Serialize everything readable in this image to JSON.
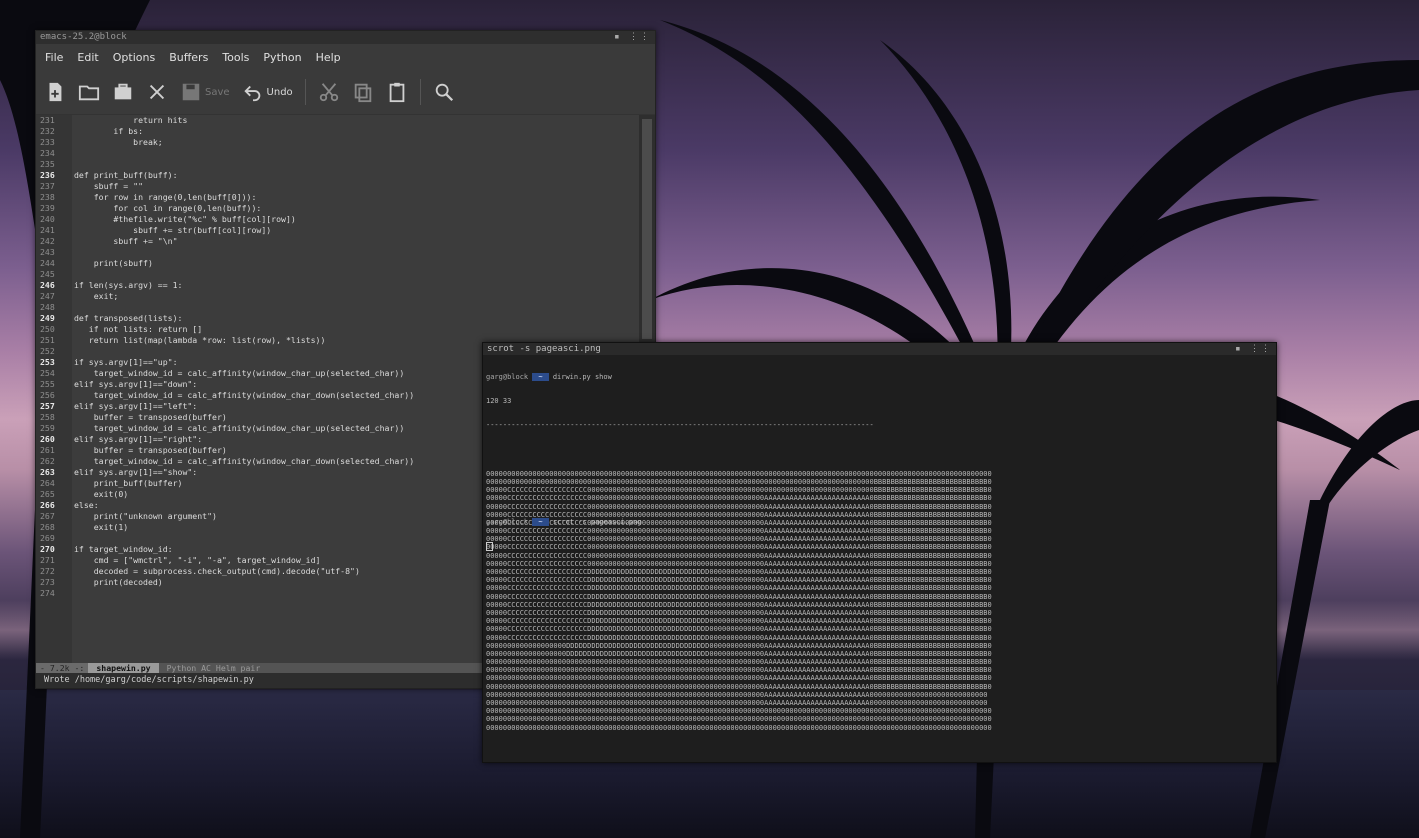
{
  "emacs": {
    "title": "emacs-25.2@block",
    "menu": [
      "File",
      "Edit",
      "Options",
      "Buffers",
      "Tools",
      "Python",
      "Help"
    ],
    "toolbar": {
      "save_label": "Save",
      "undo_label": "Undo"
    },
    "line_numbers": [
      "231",
      "232",
      "233",
      "234",
      "235",
      "236",
      "237",
      "238",
      "239",
      "240",
      "241",
      "242",
      "243",
      "244",
      "245",
      "246",
      "247",
      "248",
      "249",
      "250",
      "251",
      "252",
      "253",
      "254",
      "255",
      "256",
      "257",
      "258",
      "259",
      "260",
      "261",
      "262",
      "263",
      "264",
      "265",
      "266",
      "267",
      "268",
      "269",
      "270",
      "271",
      "272",
      "273",
      "274"
    ],
    "highlighted_lines": [
      "236",
      "246",
      "249",
      "253",
      "257",
      "260",
      "263",
      "266",
      "270"
    ],
    "code": [
      "            return hits",
      "        if bs:",
      "            break;",
      "",
      "",
      "def print_buff(buff):",
      "    sbuff = \"\"",
      "    for row in range(0,len(buff[0])):",
      "        for col in range(0,len(buff)):",
      "        #thefile.write(\"%c\" % buff[col][row])",
      "            sbuff += str(buff[col][row])",
      "        sbuff += \"\\n\"",
      "",
      "    print(sbuff)",
      "",
      "if len(sys.argv) == 1:",
      "    exit;",
      "",
      "def transposed(lists):",
      "   if not lists: return []",
      "   return list(map(lambda *row: list(row), *lists))",
      "",
      "if sys.argv[1]==\"up\":",
      "    target_window_id = calc_affinity(window_char_up(selected_char))",
      "elif sys.argv[1]==\"down\":",
      "    target_window_id = calc_affinity(window_char_down(selected_char))",
      "elif sys.argv[1]==\"left\":",
      "    buffer = transposed(buffer)",
      "    target_window_id = calc_affinity(window_char_up(selected_char))",
      "elif sys.argv[1]==\"right\":",
      "    buffer = transposed(buffer)",
      "    target_window_id = calc_affinity(window_char_down(selected_char))",
      "elif sys.argv[1]==\"show\":",
      "    print_buff(buffer)",
      "    exit(0)",
      "else:",
      "    print(\"unknown argument\")",
      "    exit(1)",
      "",
      "if target_window_id:",
      "    cmd = [\"wmctrl\", \"-i\", \"-a\", target_window_id]",
      "    decoded = subprocess.check_output(cmd).decode(\"utf-8\")",
      "    print(decoded)",
      ""
    ],
    "modeline": {
      "size": "- 7.2k -:",
      "buffer": "shapewin.py",
      "modes": "Python AC Helm pair"
    },
    "echo": "Wrote /home/garg/code/scripts/shapewin.py"
  },
  "terminal": {
    "title": "scrot -s pageasci.png",
    "prompt_user": "garg@block",
    "prompt_dir": "~",
    "command1": "dirwin.py show",
    "output_dims": "120 33",
    "output_rule": "--------------------------------------------------------------------------------------------",
    "grid": [
      "000000000000000000000000000000000000000000000000000000000000000000000000000000000000000000000000000000000000000000000000",
      "00000000000000000000000000000000000000000000000000000000000000000000000000000000000000000000BBBBBBBBBBBBBBBBBBBBBBBBBBB0",
      "00000CCCCCCCCCCCCCCCCCCC00000000000000000000000000000000000000000000000000000000000000000000BBBBBBBBBBBBBBBBBBBBBBBBBBB0",
      "00000CCCCCCCCCCCCCCCCCCC000000000000000000000000000000000000000000AAAAAAAAAAAAAAAAAAAAAAAAA0BBBBBBBBBBBBBBBBBBBBBBBBBBB0",
      "00000CCCCCCCCCCCCCCCCCCC000000000000000000000000000000000000000000AAAAAAAAAAAAAAAAAAAAAAAAA0BBBBBBBBBBBBBBBBBBBBBBBBBBB0",
      "00000CCCCCCCCCCCCCCCCCCC000000000000000000000000000000000000000000AAAAAAAAAAAAAAAAAAAAAAAAA0BBBBBBBBBBBBBBBBBBBBBBBBBBB0",
      "00000CCCCCCCCCCCCCCCCCCC000000000000000000000000000000000000000000AAAAAAAAAAAAAAAAAAAAAAAAA0BBBBBBBBBBBBBBBBBBBBBBBBBBB0",
      "00000CCCCCCCCCCCCCCCCCCC000000000000000000000000000000000000000000AAAAAAAAAAAAAAAAAAAAAAAAA0BBBBBBBBBBBBBBBBBBBBBBBBBBB0",
      "00000CCCCCCCCCCCCCCCCCCC000000000000000000000000000000000000000000AAAAAAAAAAAAAAAAAAAAAAAAA0BBBBBBBBBBBBBBBBBBBBBBBBBBB0",
      "00000CCCCCCCCCCCCCCCCCCC000000000000000000000000000000000000000000AAAAAAAAAAAAAAAAAAAAAAAAA0BBBBBBBBBBBBBBBBBBBBBBBBBBB0",
      "00000CCCCCCCCCCCCCCCCCCC000000000000000000000000000000000000000000AAAAAAAAAAAAAAAAAAAAAAAAA0BBBBBBBBBBBBBBBBBBBBBBBBBBB0",
      "00000CCCCCCCCCCCCCCCCCCC000000000000000000000000000000000000000000AAAAAAAAAAAAAAAAAAAAAAAAA0BBBBBBBBBBBBBBBBBBBBBBBBBBB0",
      "00000CCCCCCCCCCCCCCCCCCCDDDDDDDDDDDDDDDDDDDDDDDDDDDDD0000000000000AAAAAAAAAAAAAAAAAAAAAAAAA0BBBBBBBBBBBBBBBBBBBBBBBBBBB0",
      "00000CCCCCCCCCCCCCCCCCCCDDDDDDDDDDDDDDDDDDDDDDDDDDDDD0000000000000AAAAAAAAAAAAAAAAAAAAAAAAA0BBBBBBBBBBBBBBBBBBBBBBBBBBB0",
      "00000CCCCCCCCCCCCCCCCCCCDDDDDDDDDDDDDDDDDDDDDDDDDDDDD0000000000000AAAAAAAAAAAAAAAAAAAAAAAAA0BBBBBBBBBBBBBBBBBBBBBBBBBBB0",
      "00000CCCCCCCCCCCCCCCCCCCDDDDDDDDDDDDDDDDDDDDDDDDDDDDD0000000000000AAAAAAAAAAAAAAAAAAAAAAAAA0BBBBBBBBBBBBBBBBBBBBBBBBBBB0",
      "00000CCCCCCCCCCCCCCCCCCCDDDDDDDDDDDDDDDDDDDDDDDDDDDDD0000000000000AAAAAAAAAAAAAAAAAAAAAAAAA0BBBBBBBBBBBBBBBBBBBBBBBBBBB0",
      "00000CCCCCCCCCCCCCCCCCCCDDDDDDDDDDDDDDDDDDDDDDDDDDDDD0000000000000AAAAAAAAAAAAAAAAAAAAAAAAA0BBBBBBBBBBBBBBBBBBBBBBBBBBB0",
      "00000CCCCCCCCCCCCCCCCCCCDDDDDDDDDDDDDDDDDDDDDDDDDDDDD0000000000000AAAAAAAAAAAAAAAAAAAAAAAAA0BBBBBBBBBBBBBBBBBBBBBBBBBBB0",
      "00000CCCCCCCCCCCCCCCCCCCDDDDDDDDDDDDDDDDDDDDDDDDDDDDD0000000000000AAAAAAAAAAAAAAAAAAAAAAAAA0BBBBBBBBBBBBBBBBBBBBBBBBBBB0",
      "00000CCCCCCCCCCCCCCCCCCCDDDDDDDDDDDDDDDDDDDDDDDDDDDDD0000000000000AAAAAAAAAAAAAAAAAAAAAAAAA0BBBBBBBBBBBBBBBBBBBBBBBBBBB0",
      "0000000000000000000DDDDDDDDDDDDDDDDDDDDDDDDDDDDDDDDDD0000000000000AAAAAAAAAAAAAAAAAAAAAAAAA0BBBBBBBBBBBBBBBBBBBBBBBBBBB0",
      "0000000000000000000DDDDDDDDDDDDDDDDDDDDDDDDDDDDDDDDDD0000000000000AAAAAAAAAAAAAAAAAAAAAAAAA0BBBBBBBBBBBBBBBBBBBBBBBBBBB0",
      "000000000000000000000000000000000000000000000000000000000000000000AAAAAAAAAAAAAAAAAAAAAAAAA0BBBBBBBBBBBBBBBBBBBBBBBBBBB0",
      "000000000000000000000000000000000000000000000000000000000000000000AAAAAAAAAAAAAAAAAAAAAAAAA0BBBBBBBBBBBBBBBBBBBBBBBBBBB0",
      "000000000000000000000000000000000000000000000000000000000000000000AAAAAAAAAAAAAAAAAAAAAAAAA0BBBBBBBBBBBBBBBBBBBBBBBBBBB0",
      "000000000000000000000000000000000000000000000000000000000000000000AAAAAAAAAAAAAAAAAAAAAAAAA0BBBBBBBBBBBBBBBBBBBBBBBBBBB0",
      "000000000000000000000000000000000000000000000000000000000000000000AAAAAAAAAAAAAAAAAAAAAAAAA0000000000000000000000000000",
      "000000000000000000000000000000000000000000000000000000000000000000AAAAAAAAAAAAAAAAAAAAAAAAA0000000000000000000000000000",
      "000000000000000000000000000000000000000000000000000000000000000000000000000000000000000000000000000000000000000000000000",
      "000000000000000000000000000000000000000000000000000000000000000000000000000000000000000000000000000000000000000000000000",
      "000000000000000000000000000000000000000000000000000000000000000000000000000000000000000000000000000000000000000000000000"
    ],
    "command2": "scrot -s pageasci.png"
  }
}
